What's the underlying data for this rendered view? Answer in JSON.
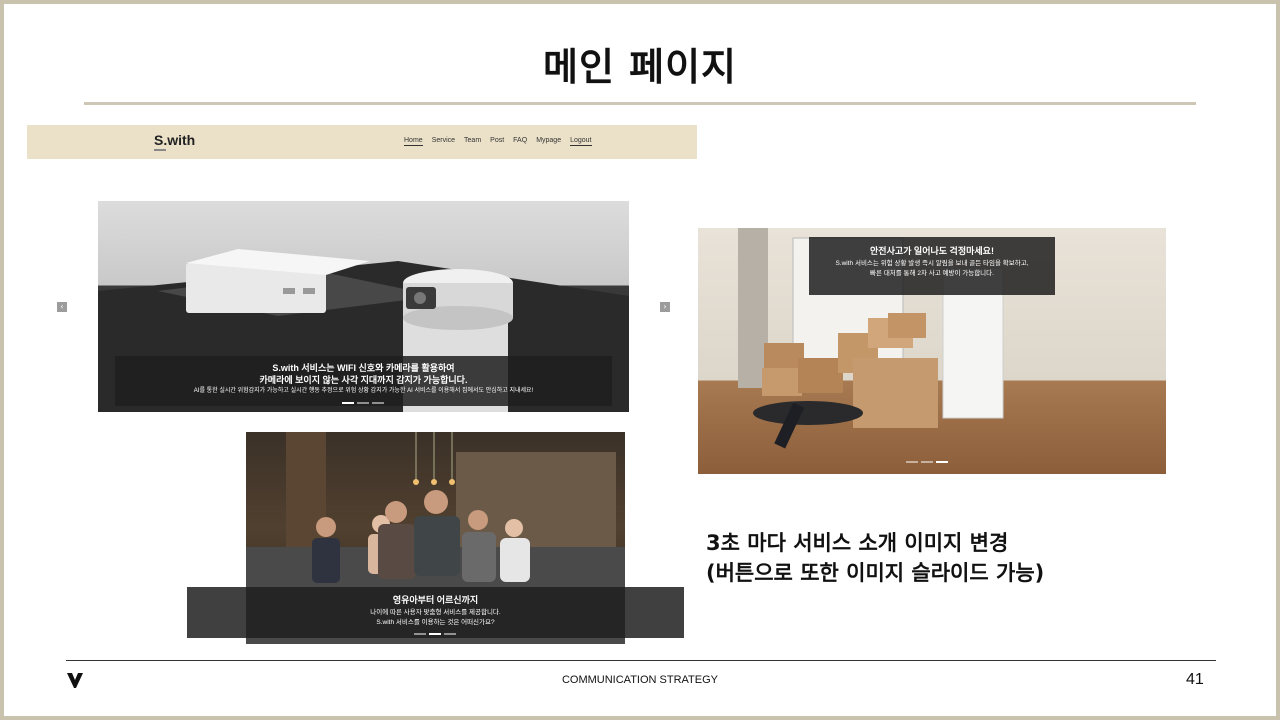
{
  "slide": {
    "title": "메인 페이지",
    "page_number": "41",
    "footer_label": "COMMUNICATION STRATEGY"
  },
  "site": {
    "logo": "S.with",
    "nav": [
      "Home",
      "Service",
      "Team",
      "Post",
      "FAQ",
      "Mypage",
      "Logout"
    ],
    "active_nav": "Home"
  },
  "slides": [
    {
      "title_line1": "S.with 서비스는 WIFI 신호와 카메라를 활용하여",
      "title_line2": "카메라에 보이지 않는 사각 지대까지 감지가 가능합니다.",
      "text": "AI를 통한 실시간 위험감지가 가능하고 실시간 행동 추정으로 위험 상황 감지가 가능한 AI 서비스를 이용해서 집에서도 안심하고 지내세요!"
    },
    {
      "title_line1": "안전사고가 일어나도 걱정마세요!",
      "text_line1": "S.with 서비스는 위험 상황 발생 즉시 알림을 보내 골든 타임을 확보하고,",
      "text_line2": "빠른 대처를 통해 2차 사고 예방이 가능합니다."
    },
    {
      "title_line1": "영유아부터 어르신까지",
      "text_line1": "나이에 따른 사용자 맞춤형 서비스를 제공합니다.",
      "text_line2": "S.with 서비스를 이용하는 것은 어떠신가요?"
    }
  ],
  "note": {
    "line1": "3초 마다 서비스 소개 이미지 변경",
    "line2": "(버튼으로 또한 이미지 슬라이드 가능)"
  },
  "icons": {
    "prev": "chevron-left-icon",
    "next": "chevron-right-icon",
    "brand": "brand-logo-icon"
  }
}
